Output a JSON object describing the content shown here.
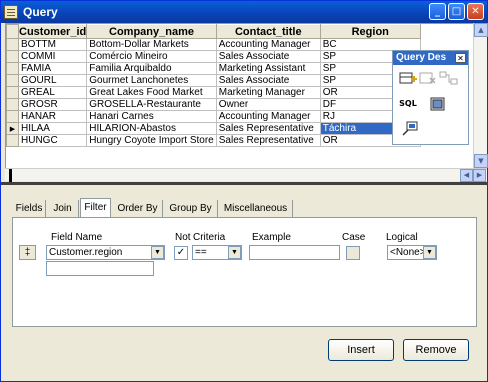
{
  "window": {
    "title": "Query"
  },
  "titlebar_buttons": {
    "minimize": "_",
    "maximize": "□",
    "close": "✕"
  },
  "grid": {
    "columns": [
      "Customer_id",
      "Company_name",
      "Contact_title",
      "Region"
    ],
    "rows": [
      [
        "BOTTM",
        "Bottom-Dollar Markets",
        "Accounting Manager",
        "BC"
      ],
      [
        "COMMI",
        "Comércio Mineiro",
        "Sales Associate",
        "SP"
      ],
      [
        "FAMIA",
        "Familia Arquibaldo",
        "Marketing Assistant",
        "SP"
      ],
      [
        "GOURL",
        "Gourmet Lanchonetes",
        "Sales Associate",
        "SP"
      ],
      [
        "GREAL",
        "Great Lakes Food Market",
        "Marketing Manager",
        "OR"
      ],
      [
        "GROSR",
        "GROSELLA-Restaurante",
        "Owner",
        "DF"
      ],
      [
        "HANAR",
        "Hanari Carnes",
        "Accounting Manager",
        "RJ"
      ],
      [
        "HILAA",
        "HILARION-Abastos",
        "Sales Representative",
        "Táchira"
      ],
      [
        "HUNGC",
        "Hungry Coyote Import Store",
        "Sales Representative",
        "OR"
      ]
    ],
    "current_row_marker": "▶",
    "selected_row": 7
  },
  "toolbox": {
    "title": "Query Des",
    "close": "✕",
    "sql_label": "SQL"
  },
  "tabs": [
    "Fields",
    "Join",
    "Filter",
    "Order By",
    "Group By",
    "Miscellaneous"
  ],
  "active_tab": "Filter",
  "filter": {
    "headers": {
      "field_name": "Field Name",
      "not": "Not",
      "criteria": "Criteria",
      "example": "Example",
      "case": "Case",
      "logical": "Logical"
    },
    "row": {
      "mover": "‡",
      "field_name": "Customer.region",
      "not_check": "✓",
      "criteria": "==",
      "example": "",
      "logical": "<None>"
    }
  },
  "buttons": {
    "insert": "Insert",
    "remove": "Remove"
  }
}
